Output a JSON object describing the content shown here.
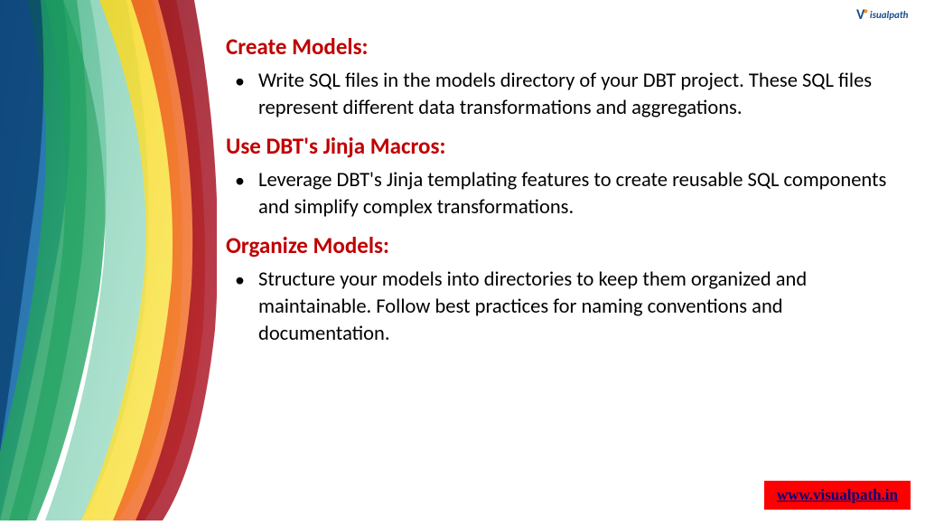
{
  "logo": {
    "text": "isualpath",
    "v": "V"
  },
  "sections": [
    {
      "heading": "Create Models:",
      "bullets": [
        "Write SQL files in the models directory of your DBT project. These SQL files represent different data transformations and aggregations."
      ]
    },
    {
      "heading": "Use DBT's Jinja Macros:",
      "bullets": [
        "Leverage DBT's Jinja templating features to create reusable SQL components and simplify complex transformations."
      ]
    },
    {
      "heading": "Organize Models:",
      "bullets": [
        "Structure your models into directories to keep them organized and maintainable. Follow best practices for naming conventions and documentation."
      ]
    }
  ],
  "footer": {
    "link_text": "www.visualpath.in"
  }
}
